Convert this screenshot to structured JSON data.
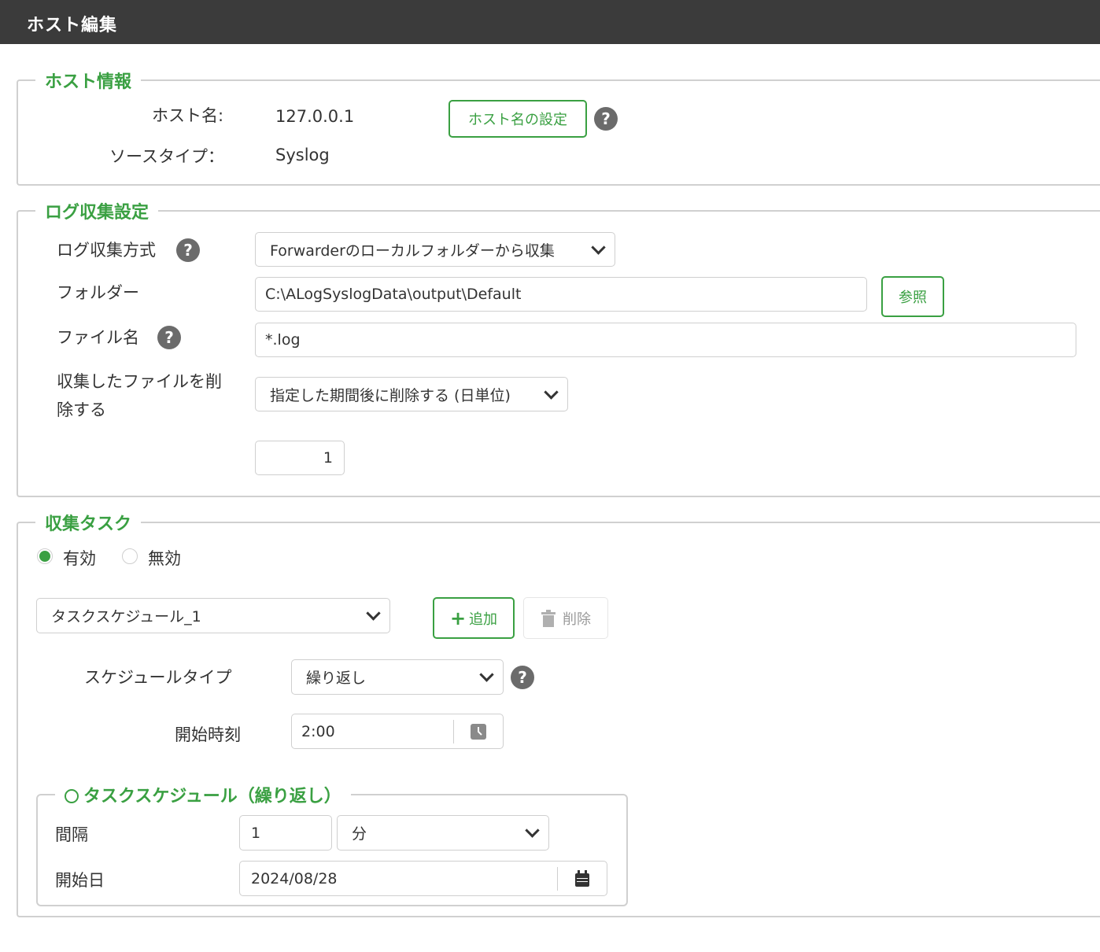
{
  "window": {
    "title": "ホスト編集"
  },
  "host_info": {
    "legend": "ホスト情報",
    "host_name_label": "ホスト名:",
    "host_name_value": "127.0.0.1",
    "set_host_name_button": "ホスト名の設定",
    "help_mark": "?",
    "source_type_label": "ソースタイプ：",
    "source_type_value": "Syslog"
  },
  "log_collection": {
    "legend": "ログ収集設定",
    "method_label": "ログ収集方式",
    "method_value": "Forwarderのローカルフォルダーから収集",
    "folder_label": "フォルダー",
    "folder_value": "C:\\ALogSyslogData\\output\\Default",
    "browse_button": "参照",
    "filename_label": "ファイル名",
    "filename_value": "*.log",
    "delete_label_line1": "収集したファイルを削",
    "delete_label_line2": "除する",
    "delete_value": "指定した期間後に削除する (日単位)",
    "days_value": "1"
  },
  "collection_task": {
    "legend": "収集タスク",
    "enabled_label": "有効",
    "disabled_label": "無効",
    "enabled": true,
    "schedule_select": "タスクスケジュール_1",
    "add_button": "追加",
    "delete_button": "削除",
    "schedule_type_label": "スケジュールタイプ",
    "schedule_type_value": "繰り返し",
    "start_time_label": "開始時刻",
    "start_time_value": "2:00",
    "repeat": {
      "legend": "タスクスケジュール（繰り返し）",
      "interval_label": "間隔",
      "interval_value": "1",
      "interval_unit": "分",
      "start_date_label": "開始日",
      "start_date_value": "2024/08/28"
    }
  },
  "colors": {
    "accent": "#3aa042",
    "titlebar": "#3b3b3b",
    "border": "#d0d0d0"
  }
}
